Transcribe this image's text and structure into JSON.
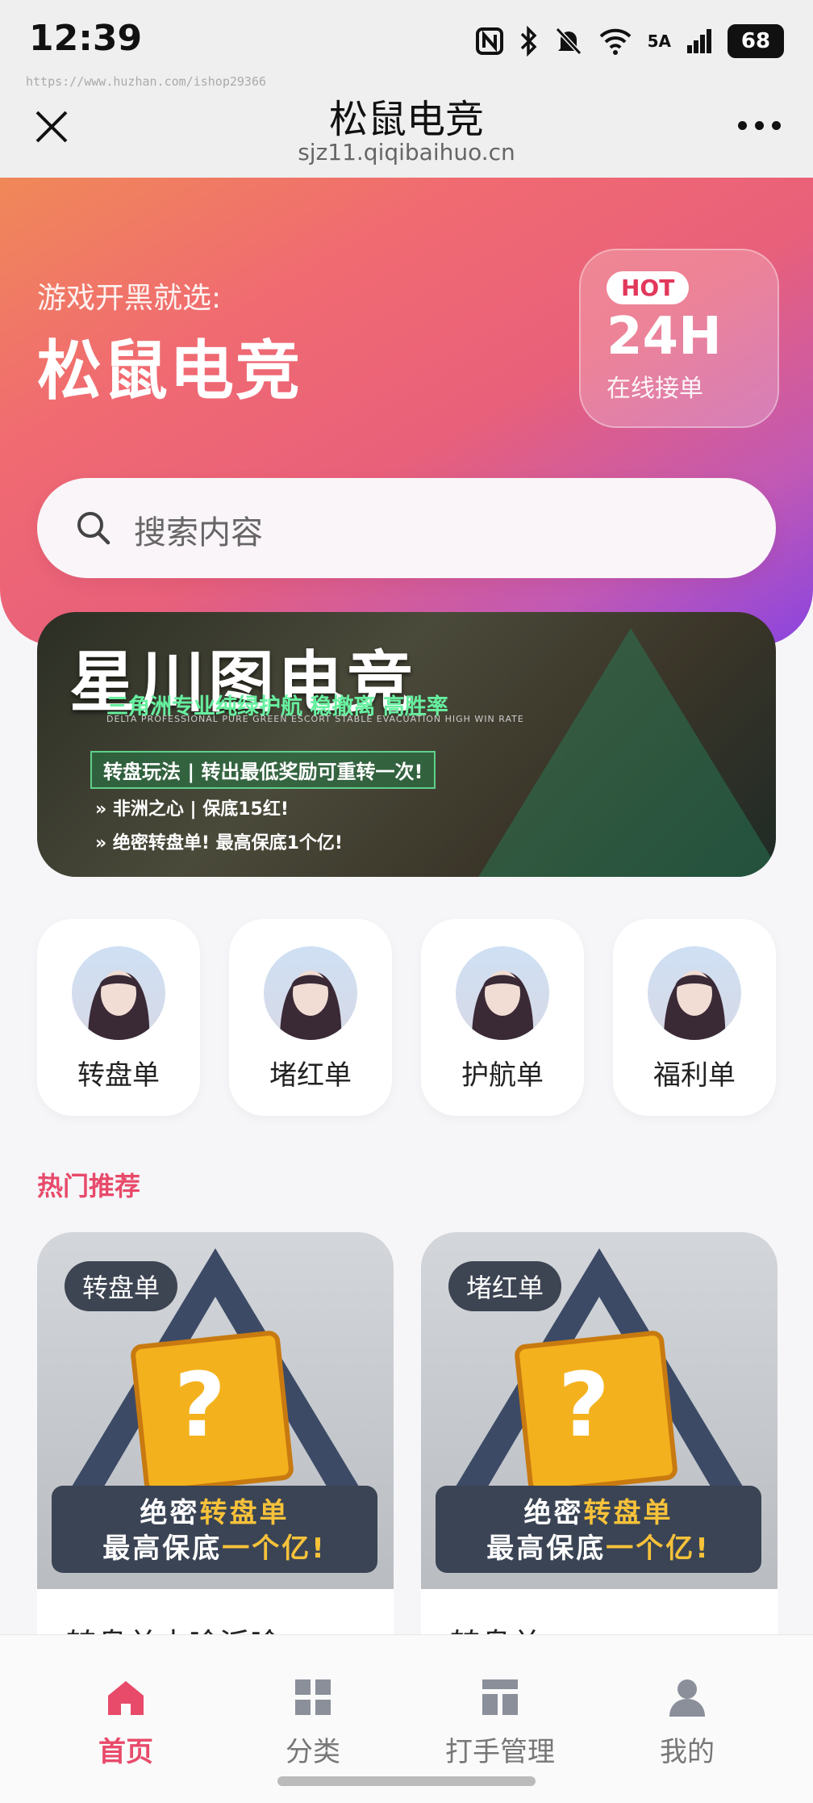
{
  "status_bar": {
    "time": "12:39",
    "battery": "68",
    "network": "5A"
  },
  "watermark": "https://www.huzhan.com/ishop29366",
  "nav": {
    "title": "松鼠电竞",
    "url": "sjz11.qiqibaihuo.cn"
  },
  "hero": {
    "subtitle": "游戏开黑就选:",
    "title": "松鼠电竞",
    "badge_hot": "HOT",
    "badge_main": "24H",
    "badge_sub": "在线接单"
  },
  "search": {
    "placeholder": "搜索内容"
  },
  "banner": {
    "title": "星川图电竞",
    "tagline": "三角洲专业纯绿护航 稳撤离 高胜率",
    "tagline_en": "DELTA PROFESSIONAL PURE GREEN ESCORT STABLE EVACUATION HIGH WIN RATE",
    "box": "转盘玩法 | 转出最低奖励可重转一次!",
    "line1": "非洲之心 | 保底15红!",
    "line2": "绝密转盘单! 最高保底1个亿!"
  },
  "categories": [
    {
      "label": "转盘单"
    },
    {
      "label": "堵红单"
    },
    {
      "label": "护航单"
    },
    {
      "label": "福利单"
    }
  ],
  "section_title": "热门推荐",
  "cards": [
    {
      "tag": "转盘单",
      "line1_a": "绝密",
      "line1_b": "转盘单",
      "line2_a": "最高保底",
      "line2_b": "一个亿!",
      "title": "转盘单中啥派啥"
    },
    {
      "tag": "堵红单",
      "line1_a": "绝密",
      "line1_b": "转盘单",
      "line2_a": "最高保底",
      "line2_b": "一个亿!",
      "title": "转盘单"
    }
  ],
  "tabs": [
    {
      "label": "首页",
      "icon": "home-icon",
      "active": true
    },
    {
      "label": "分类",
      "icon": "grid-icon"
    },
    {
      "label": "打手管理",
      "icon": "manage-icon"
    },
    {
      "label": "我的",
      "icon": "user-icon"
    }
  ],
  "colors": {
    "accent": "#e84a6a",
    "hero_start": "#f08858",
    "hero_end": "#8a44e0"
  }
}
